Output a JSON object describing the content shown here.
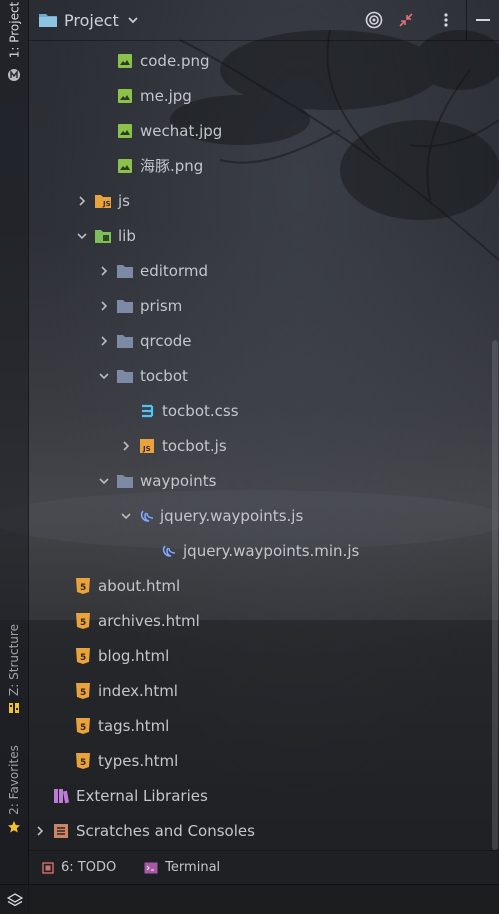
{
  "header": {
    "title": "Project",
    "actions": [
      "locate-icon",
      "collapse-icon",
      "more-icon",
      "hide-icon"
    ]
  },
  "left_strip": {
    "project_tab": "1: Project",
    "structure_tab": "Z: Structure",
    "favorites_tab": "2: Favorites"
  },
  "tree": {
    "items": [
      {
        "label": "code.png",
        "icon": "image-icon"
      },
      {
        "label": "me.jpg",
        "icon": "image-icon"
      },
      {
        "label": "wechat.jpg",
        "icon": "image-icon"
      },
      {
        "label": "海豚.png",
        "icon": "image-icon"
      },
      {
        "label": "js",
        "icon": "js-folder-icon",
        "state": "collapsed"
      },
      {
        "label": "lib",
        "icon": "lib-folder-icon",
        "state": "expanded"
      },
      {
        "label": "editormd",
        "icon": "folder-icon",
        "state": "collapsed"
      },
      {
        "label": "prism",
        "icon": "folder-icon",
        "state": "collapsed"
      },
      {
        "label": "qrcode",
        "icon": "folder-icon",
        "state": "collapsed"
      },
      {
        "label": "tocbot",
        "icon": "folder-icon",
        "state": "expanded"
      },
      {
        "label": "tocbot.css",
        "icon": "css-file-icon"
      },
      {
        "label": "tocbot.js",
        "icon": "js-file-icon",
        "state": "collapsed"
      },
      {
        "label": "waypoints",
        "icon": "folder-icon",
        "state": "expanded"
      },
      {
        "label": "jquery.waypoints.js",
        "icon": "jquery-file-icon",
        "state": "expanded"
      },
      {
        "label": "jquery.waypoints.min.js",
        "icon": "jquery-file-icon"
      },
      {
        "label": "about.html",
        "icon": "html-file-icon"
      },
      {
        "label": "archives.html",
        "icon": "html-file-icon"
      },
      {
        "label": "blog.html",
        "icon": "html-file-icon"
      },
      {
        "label": "index.html",
        "icon": "html-file-icon"
      },
      {
        "label": "tags.html",
        "icon": "html-file-icon"
      },
      {
        "label": "types.html",
        "icon": "html-file-icon"
      },
      {
        "label": "External Libraries",
        "icon": "external-libraries-icon"
      },
      {
        "label": "Scratches and Consoles",
        "icon": "scratches-icon",
        "state": "collapsed"
      }
    ]
  },
  "bottom_tabs": {
    "todo": "6: TODO",
    "terminal": "Terminal"
  },
  "colors": {
    "folder": "#7c8aa6",
    "image": "#8bc34a",
    "html": "#e8a33d",
    "js": "#e8a33d",
    "css": "#4fc3f7",
    "jquery": "#7fa8ff",
    "star": "#f2c12e"
  }
}
